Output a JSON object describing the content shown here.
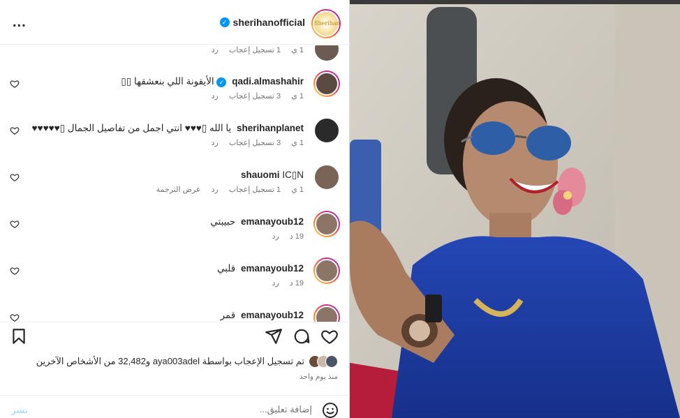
{
  "header": {
    "username": "sherihanofficial",
    "verified": true,
    "avatar_text": "Sherihan",
    "more_label": "..."
  },
  "comments": [
    {
      "username": "",
      "text": "",
      "meta": [
        "1 ي",
        "1 تسجيل إعجاب",
        "رد"
      ]
    },
    {
      "username": "qadi.almashahir",
      "verified": true,
      "text": "الأيقونة اللي بنعشقها ▯▯",
      "meta": [
        "1 ي",
        "3 تسجيل إعجاب",
        "رد"
      ]
    },
    {
      "username": "sherihanplanet",
      "text": "يا الله ▯♥♥♥ انتي اجمل من تفاصيل الجمال ▯♥♥♥♥♥",
      "meta": [
        "1 ي",
        "3 تسجيل إعجاب",
        "رد"
      ]
    },
    {
      "username": "shauomi",
      "text": "IC▯N",
      "meta": [
        "1 ي",
        "1 تسجيل إعجاب",
        "رد",
        "عرض الترجمة"
      ]
    },
    {
      "username": "emanayoub12",
      "text": "حبيبتي",
      "meta": [
        "19 د",
        "رد"
      ]
    },
    {
      "username": "emanayoub12",
      "text": "قلبي",
      "meta": [
        "19 د",
        "رد"
      ]
    },
    {
      "username": "emanayoub12",
      "text": "قمر",
      "meta": []
    }
  ],
  "icons": {
    "like": "heart-icon",
    "comment": "comment-icon",
    "share": "share-icon",
    "save": "bookmark-icon",
    "emoji": "emoji-icon"
  },
  "likes": {
    "text": "تم تسجيل الإعجاب بواسطة aya003adel و32,482 من الأشخاص الآخرين"
  },
  "time_ago": "منذ يوم واحد",
  "add_comment": {
    "placeholder": "إضافة تعليق...",
    "post_label": "نشر"
  },
  "colors": {
    "accent": "#0095f6",
    "muted": "#737373",
    "post_disabled": "#b2dffc",
    "dress": "#1f3fa8"
  }
}
